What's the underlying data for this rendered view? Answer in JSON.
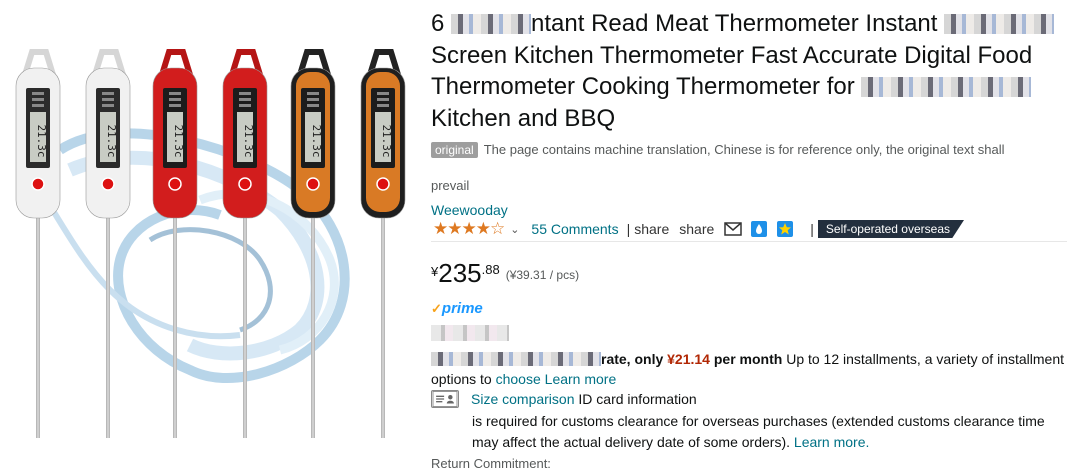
{
  "product": {
    "title_parts": [
      "6 ",
      "ntant Read Meat Thermometer Instant ",
      "Screen Kitchen Thermometer Fast Accurate Digital Food Thermometer Cooking Thermometer for ",
      "Kitchen and BBQ"
    ],
    "thermometer_display": "21.3c"
  },
  "translation": {
    "badge": "original",
    "notice": "The page contains machine translation, Chinese is for reference only, the original text shall",
    "notice_cont": "prevail"
  },
  "brand": "Weewooday",
  "rating": {
    "stars": "★★★★☆",
    "comments": "55 Comments",
    "sep": "|",
    "share1": "share",
    "share2": "share",
    "sep2": "|",
    "badge": "Self-operated overseas"
  },
  "price": {
    "currency": "¥",
    "whole": "235",
    "fraction": ".88",
    "unit": "(¥39.31 / pcs)"
  },
  "prime": {
    "check": "✓",
    "label": "prime"
  },
  "installment": {
    "rate": "rate, only ",
    "amount": "¥21.14",
    "per_month": " per month",
    "rest": " Up to 12 installments, a variety of installment options to ",
    "choose": "choose",
    "learn": "Learn more"
  },
  "customs": {
    "size_link": "Size comparison",
    "id_info": "ID card information",
    "text": "is required for customs clearance for overseas purchases (extended customs clearance time may affect the actual delivery date of some orders).",
    "learn": "Learn more."
  },
  "return": "Return Commitment:",
  "colors": {
    "white": "#f1f1f1",
    "red": "#d21d1d",
    "orange": "#d97a25",
    "link": "#007185",
    "price_red": "#b12704",
    "star": "#de7921"
  }
}
